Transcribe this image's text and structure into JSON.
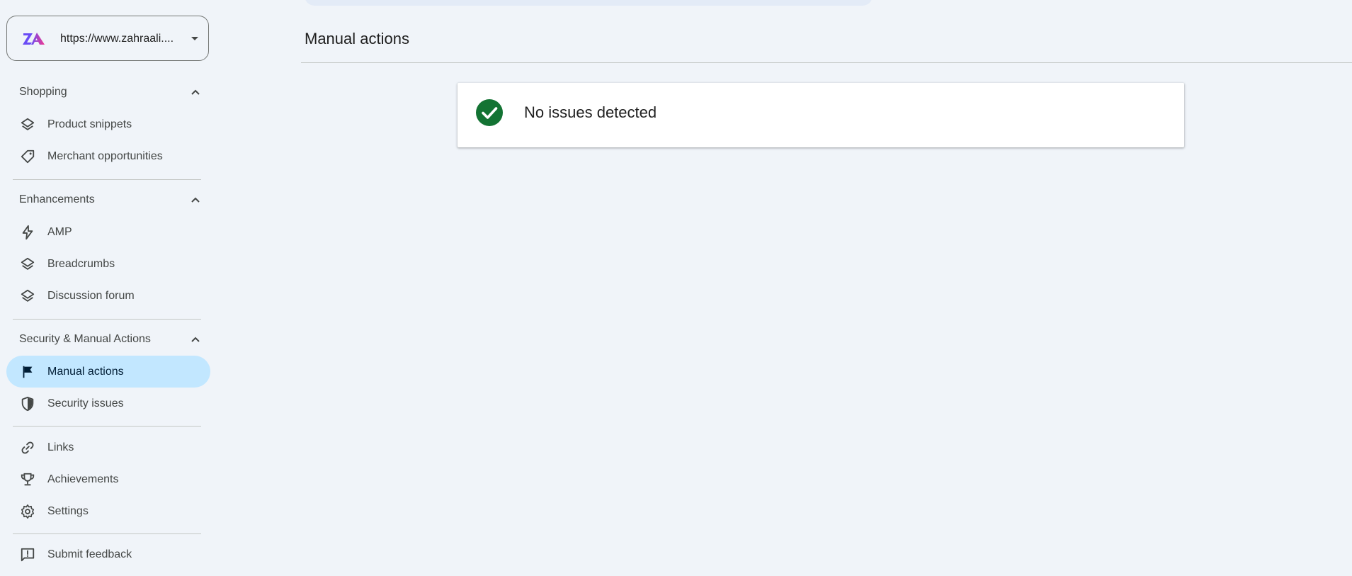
{
  "property": {
    "url": "https://www.zahraali...."
  },
  "sections": {
    "shopping": "Shopping",
    "enhancements": "Enhancements",
    "security": "Security & Manual Actions"
  },
  "nav": {
    "product_snippets": "Product snippets",
    "merchant_opportunities": "Merchant opportunities",
    "amp": "AMP",
    "breadcrumbs": "Breadcrumbs",
    "discussion_forum": "Discussion forum",
    "manual_actions": "Manual actions",
    "security_issues": "Security issues",
    "links": "Links",
    "achievements": "Achievements",
    "settings": "Settings",
    "submit_feedback": "Submit feedback"
  },
  "main": {
    "title": "Manual actions",
    "status": "No issues detected"
  },
  "colors": {
    "background": "#f0f4f9",
    "active_nav": "#c2e7ff",
    "success": "#137333",
    "card": "#ffffff"
  },
  "icons": {
    "product_snippets": "layers-icon",
    "merchant_opportunities": "tag-icon",
    "amp": "lightning-bolt-icon",
    "breadcrumbs": "layers-icon",
    "discussion_forum": "layers-icon",
    "manual_actions": "flag-icon",
    "security_issues": "shield-icon",
    "links": "link-icon",
    "achievements": "trophy-icon",
    "settings": "gear-icon",
    "submit_feedback": "feedback-icon",
    "status": "check-circle-icon"
  }
}
